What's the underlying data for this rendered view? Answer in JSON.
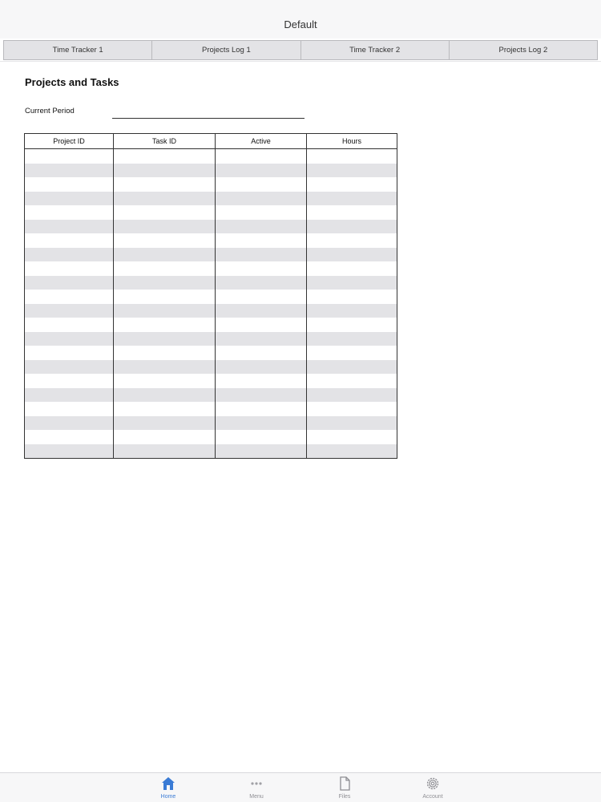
{
  "window": {
    "title": "Default"
  },
  "tabs": [
    {
      "label": "Time Tracker 1"
    },
    {
      "label": "Projects Log 1"
    },
    {
      "label": "Time Tracker 2"
    },
    {
      "label": "Projects Log 2"
    }
  ],
  "content": {
    "heading": "Projects and Tasks",
    "current_period_label": "Current Period",
    "current_period_value": ""
  },
  "table": {
    "columns": [
      "Project ID",
      "Task ID",
      "Active",
      "Hours"
    ],
    "rows": [
      [
        "",
        "",
        "",
        ""
      ],
      [
        "",
        "",
        "",
        ""
      ],
      [
        "",
        "",
        "",
        ""
      ],
      [
        "",
        "",
        "",
        ""
      ],
      [
        "",
        "",
        "",
        ""
      ],
      [
        "",
        "",
        "",
        ""
      ],
      [
        "",
        "",
        "",
        ""
      ],
      [
        "",
        "",
        "",
        ""
      ],
      [
        "",
        "",
        "",
        ""
      ],
      [
        "",
        "",
        "",
        ""
      ],
      [
        "",
        "",
        "",
        ""
      ],
      [
        "",
        "",
        "",
        ""
      ],
      [
        "",
        "",
        "",
        ""
      ],
      [
        "",
        "",
        "",
        ""
      ],
      [
        "",
        "",
        "",
        ""
      ],
      [
        "",
        "",
        "",
        ""
      ],
      [
        "",
        "",
        "",
        ""
      ],
      [
        "",
        "",
        "",
        ""
      ],
      [
        "",
        "",
        "",
        ""
      ],
      [
        "",
        "",
        "",
        ""
      ],
      [
        "",
        "",
        "",
        ""
      ],
      [
        "",
        "",
        "",
        ""
      ]
    ]
  },
  "bottom_nav": [
    {
      "label": "Home",
      "icon": "home-icon",
      "active": true
    },
    {
      "label": "Menu",
      "icon": "more-dots-icon",
      "active": false
    },
    {
      "label": "Files",
      "icon": "file-icon",
      "active": false
    },
    {
      "label": "Account",
      "icon": "gear-icon",
      "active": false
    }
  ],
  "colors": {
    "accent": "#3a7bd5",
    "row_alt": "#e3e3e6",
    "tab_bg": "#e3e3e6"
  }
}
